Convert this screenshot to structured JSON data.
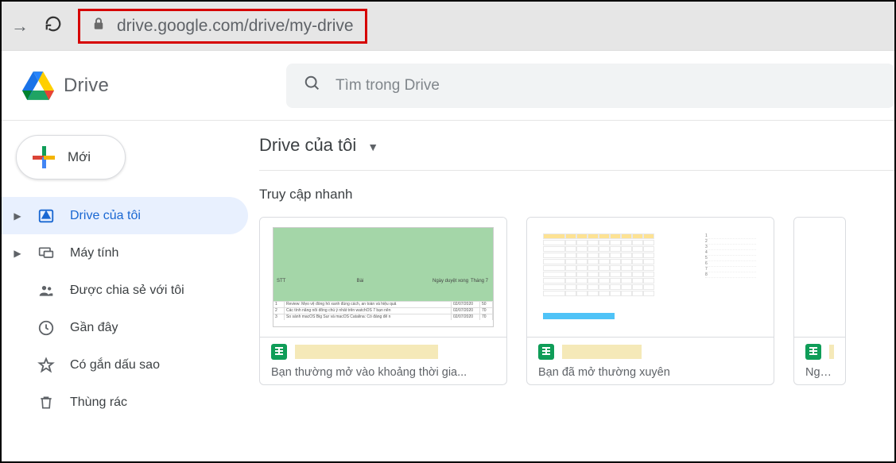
{
  "browser": {
    "url": "drive.google.com/drive/my-drive"
  },
  "header": {
    "app_name": "Drive",
    "search_placeholder": "Tìm trong Drive"
  },
  "sidebar": {
    "new_button": "Mới",
    "items": [
      {
        "label": "Drive của tôi",
        "icon": "drive",
        "expandable": true,
        "active": true
      },
      {
        "label": "Máy tính",
        "icon": "computers",
        "expandable": true,
        "active": false
      },
      {
        "label": "Được chia sẻ với tôi",
        "icon": "shared",
        "expandable": false,
        "active": false
      },
      {
        "label": "Gần đây",
        "icon": "clock",
        "expandable": false,
        "active": false
      },
      {
        "label": "Có gắn dấu sao",
        "icon": "star",
        "expandable": false,
        "active": false
      },
      {
        "label": "Thùng rác",
        "icon": "trash",
        "expandable": false,
        "active": false
      }
    ]
  },
  "content": {
    "breadcrumb": "Drive của tôi",
    "quick_access_title": "Truy cập nhanh",
    "cards": [
      {
        "subtitle": "Bạn thường mở vào khoảng thời gia..."
      },
      {
        "subtitle": "Bạn đã mở thường xuyên"
      },
      {
        "subtitle": "Người chỉnh"
      }
    ]
  }
}
